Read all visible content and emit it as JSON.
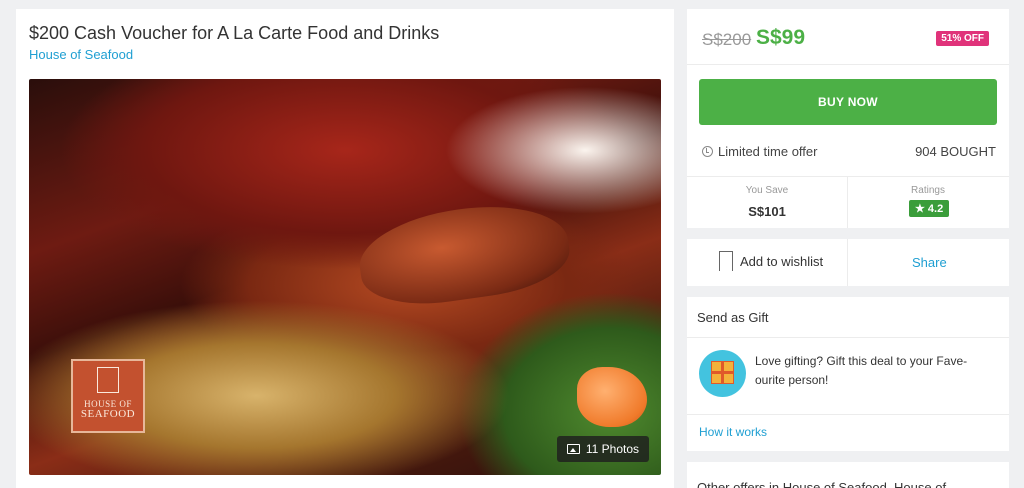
{
  "deal": {
    "title": "$200 Cash Voucher for A La Carte Food and Drinks",
    "merchant": "House of Seafood"
  },
  "gallery": {
    "logo_text_line1": "HOUSE OF",
    "logo_text_line2": "SEAFOOD",
    "photos_label": "11 Photos"
  },
  "pricing": {
    "old_price": "S$200",
    "new_price": "S$99",
    "discount": "51% OFF",
    "buy_label": "BUY NOW",
    "limited_label": "Limited time offer",
    "bought_label": "904 BOUGHT",
    "save_label": "You Save",
    "save_value": "S$101",
    "ratings_label": "Ratings",
    "ratings_value": "★ 4.2"
  },
  "actions": {
    "wishlist_label": "Add to wishlist",
    "share_label": "Share"
  },
  "gift": {
    "title": "Send as Gift",
    "description": "Love gifting? Gift this deal to your Fave-ourite person!",
    "how_label": "How it works"
  },
  "other": {
    "title": "Other offers in House of Seafood, House of"
  },
  "colors": {
    "accent_green": "#4cb046",
    "link_blue": "#1f9fd2",
    "discount_pink": "#e0337a",
    "rating_green": "#3a9d3a"
  }
}
